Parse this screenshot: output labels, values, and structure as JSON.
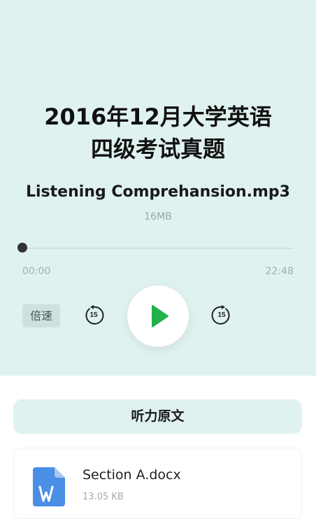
{
  "player": {
    "title_line1": "2016年12月大学英语",
    "title_line2": "四级考试真题",
    "file_name": "Listening Comprehansion.mp3",
    "file_size": "16MB",
    "progress": 0,
    "time_current": "00:00",
    "time_total": "22:48",
    "speed_label": "倍速",
    "skip_back_seconds": "15",
    "skip_forward_seconds": "15",
    "accent_color": "#22b14c"
  },
  "transcript": {
    "header": "听力原文",
    "files": [
      {
        "name": "Section A.docx",
        "size": "13.05 KB"
      }
    ]
  }
}
